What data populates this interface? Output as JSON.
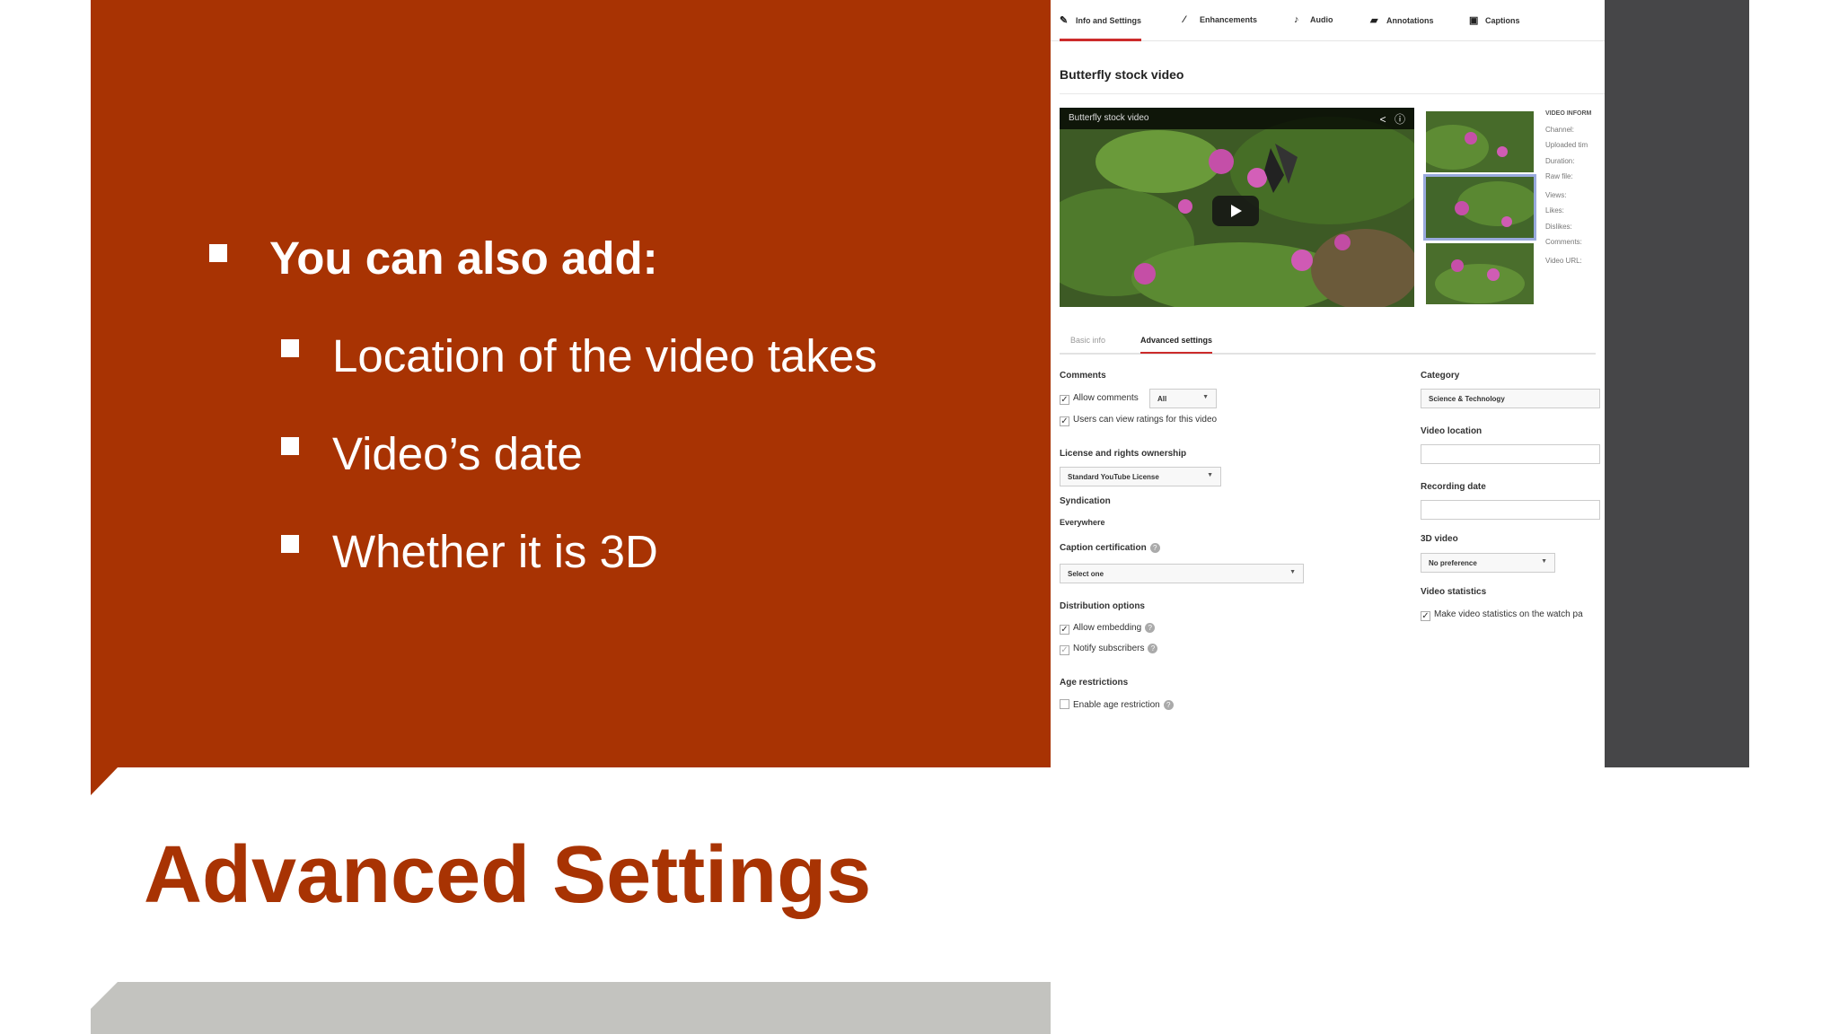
{
  "slide": {
    "title": "Advanced Settings",
    "bullet_main": "You can also add:",
    "sub_bullets": [
      "Location of the video takes",
      "Video’s date",
      "Whether it is 3D"
    ],
    "colors": {
      "accent": "#a83303",
      "band": "#c3c3bf",
      "sidebar": "#464648"
    }
  },
  "youtube": {
    "tabs": [
      {
        "label": "Info and Settings",
        "icon": "pencil-icon",
        "glyph": "✎",
        "active": true
      },
      {
        "label": "Enhancements",
        "icon": "wand-icon",
        "glyph": "⁄",
        "active": false
      },
      {
        "label": "Audio",
        "icon": "music-note-icon",
        "glyph": "♪",
        "active": false
      },
      {
        "label": "Annotations",
        "icon": "speech-bubble-icon",
        "glyph": "▰",
        "active": false
      },
      {
        "label": "Captions",
        "icon": "cc-icon",
        "glyph": "▣",
        "active": false
      }
    ],
    "video_title": "Butterfly stock video",
    "player": {
      "title": "Butterfly stock video",
      "share_icon": "share-icon",
      "info_icon": "info-icon"
    },
    "video_info": {
      "heading": "VIDEO INFORM",
      "fields": [
        "Channel:",
        "Uploaded tim",
        "Duration:",
        "Raw file:",
        "Views:",
        "Likes:",
        "Dislikes:",
        "Comments:",
        "Video URL:"
      ]
    },
    "sub_tabs": [
      {
        "label": "Basic info",
        "active": false
      },
      {
        "label": "Advanced settings",
        "active": true
      }
    ],
    "left": {
      "comments_label": "Comments",
      "allow_comments": "Allow comments",
      "allow_comments_value": "All",
      "ratings": "Users can view ratings for this video",
      "license_label": "License and rights ownership",
      "license_value": "Standard YouTube License",
      "syndication_label": "Syndication",
      "syndication_value": "Everywhere",
      "caption_label": "Caption certification",
      "caption_value": "Select one",
      "distribution_label": "Distribution options",
      "allow_embedding": "Allow embedding",
      "notify_subscribers": "Notify subscribers",
      "age_label": "Age restrictions",
      "age_restriction": "Enable age restriction"
    },
    "right": {
      "category_label": "Category",
      "category_value": "Science & Technology",
      "location_label": "Video location",
      "recording_label": "Recording date",
      "threed_label": "3D video",
      "threed_value": "No preference",
      "stats_label": "Video statistics",
      "stats_option": "Make video statistics on the watch pa"
    }
  }
}
